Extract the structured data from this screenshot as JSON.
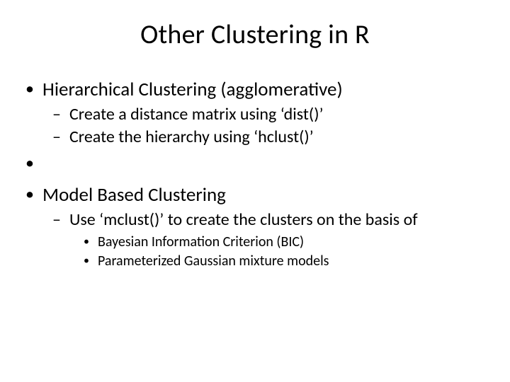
{
  "title": "Other Clustering in R",
  "sections": [
    {
      "heading": "Hierarchical Clustering (agglomerative)",
      "sub": [
        "Create a distance matrix using ‘dist()’",
        "Create the hierarchy using ‘hclust()’"
      ]
    },
    {
      "heading": "Model Based Clustering",
      "sub": [
        "Use ‘mclust()’ to create the clusters on the basis of"
      ],
      "subsub": [
        "Bayesian Information Criterion (BIC)",
        "Parameterized Gaussian mixture models"
      ]
    }
  ]
}
